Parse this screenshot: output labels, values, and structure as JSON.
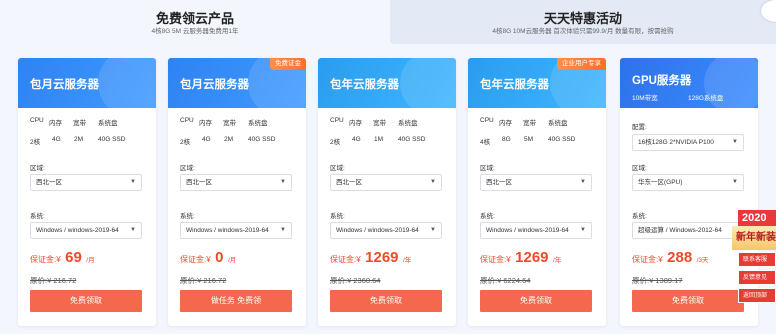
{
  "tabs": [
    {
      "title": "免费领云产品",
      "sub": "4核8G 5M 云服务器免费用1年"
    },
    {
      "title": "天天特惠活动",
      "sub": "4核8G 10M云服务器 首次体验只需99.9/月 数量有限，按需抢购"
    }
  ],
  "spec_headers": [
    "CPU",
    "内存",
    "宽带",
    "系统盘"
  ],
  "labels": {
    "region": "区域:",
    "system": "系统:",
    "config": "配置:",
    "deposit": "保证金:",
    "original": "原价:",
    "currency": "¥"
  },
  "cards": [
    {
      "title": "包月云服务器",
      "badge": "",
      "specs": [
        "2核",
        "4G",
        "2M",
        "40G SSD"
      ],
      "region": "西北一区",
      "system": "Windows / windows-2019-64",
      "price": "69",
      "unit": "/月",
      "original": "¥ 216.72",
      "button": "免费领取"
    },
    {
      "title": "包月云服务器",
      "badge": "免费证金",
      "specs": [
        "2核",
        "4G",
        "2M",
        "40G SSD"
      ],
      "region": "西北一区",
      "system": "Windows / windows-2019-64",
      "price": "0",
      "unit": "/月",
      "original": "¥ 216.72",
      "button": "做任务 免费领"
    },
    {
      "title": "包年云服务器",
      "badge": "",
      "specs": [
        "2核",
        "4G",
        "1M",
        "40G SSD"
      ],
      "region": "西北一区",
      "system": "Windows / windows-2019-64",
      "price": "1269",
      "unit": "/年",
      "original": "¥ 2360.64",
      "button": "免费领取"
    },
    {
      "title": "包年云服务器",
      "badge": "企业用户专享",
      "specs": [
        "4核",
        "8G",
        "5M",
        "40G SSD"
      ],
      "region": "西北一区",
      "system": "Windows / windows-2019-64",
      "price": "1269",
      "unit": "/年",
      "original": "¥ 6224.64",
      "button": "免费领取"
    },
    {
      "title": "GPU服务器",
      "badge": "",
      "gpu_specs": [
        "10M带宽",
        "128G系统盘"
      ],
      "config": "16核128G 2*NVIDIA P100",
      "region": "华东一区(GPU)",
      "system": "超级运算 / Windows-2012-64",
      "price": "288",
      "unit": "/3天",
      "original": "¥ 1389.17",
      "button": "免费领取"
    }
  ],
  "float": {
    "year": "2020",
    "banner": "新年新装",
    "buttons": [
      "联系客服",
      "反馈意见",
      "返回顶部"
    ]
  },
  "colors": {
    "price": "#f0492a",
    "button": "#f4694e",
    "head_blue": "#2e7cf0"
  }
}
